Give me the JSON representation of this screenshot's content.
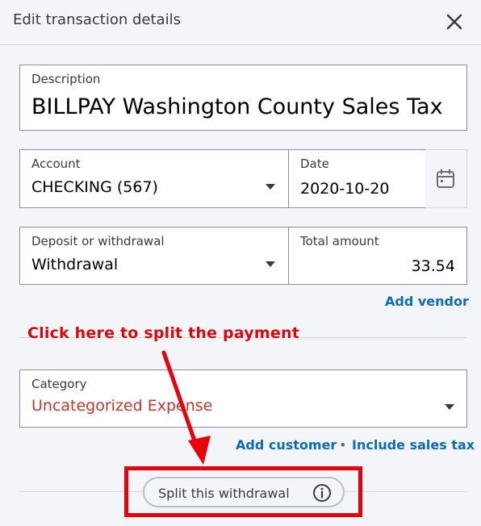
{
  "header": {
    "title": "Edit transaction details"
  },
  "description": {
    "label": "Description",
    "value": "BILLPAY Washington County Sales Tax"
  },
  "account": {
    "label": "Account",
    "value": "CHECKING (567)"
  },
  "date": {
    "label": "Date",
    "value": "2020-10-20"
  },
  "type": {
    "label": "Deposit or withdrawal",
    "value": "Withdrawal"
  },
  "total": {
    "label": "Total amount",
    "value": "33.54"
  },
  "links": {
    "add_vendor": "Add vendor",
    "add_customer": "Add customer",
    "separator": "•",
    "include_sales_tax": "Include sales tax"
  },
  "category": {
    "label": "Category",
    "value": "Uncategorized Expense",
    "value_color": "#c0392b"
  },
  "split_button": {
    "label": "Split this withdrawal"
  },
  "annotation": {
    "text": "Click here to split the payment",
    "color": "#e8000b"
  },
  "icons": {
    "close": "close-icon",
    "calendar": "calendar-icon",
    "info": "info-icon",
    "caret": "chevron-down-icon"
  }
}
